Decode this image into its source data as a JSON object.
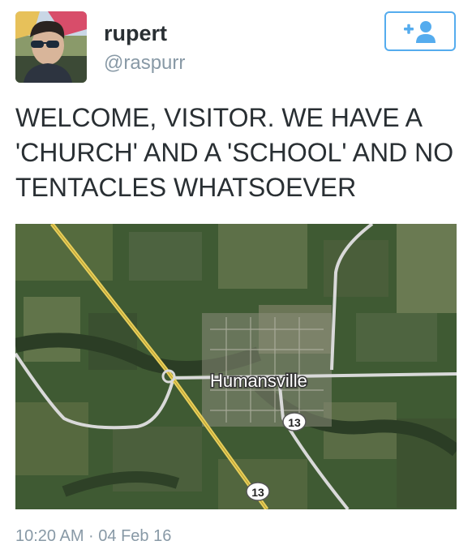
{
  "user": {
    "display_name": "rupert",
    "handle": "@raspurr",
    "follow_icon": "add-user-icon"
  },
  "tweet": {
    "lines": [
      "WELCOME, VISITOR. WE HAVE A",
      "'CHURCH' AND A 'SCHOOL' AND NO",
      "TENTACLES WHATSOEVER"
    ],
    "timestamp": "10:20 AM · 04 Feb 16"
  },
  "map": {
    "place_label": "Humansville",
    "route_shields": [
      "13",
      "13"
    ]
  },
  "colors": {
    "accent": "#55acee",
    "text": "#292f33",
    "muted": "#8899a6"
  }
}
